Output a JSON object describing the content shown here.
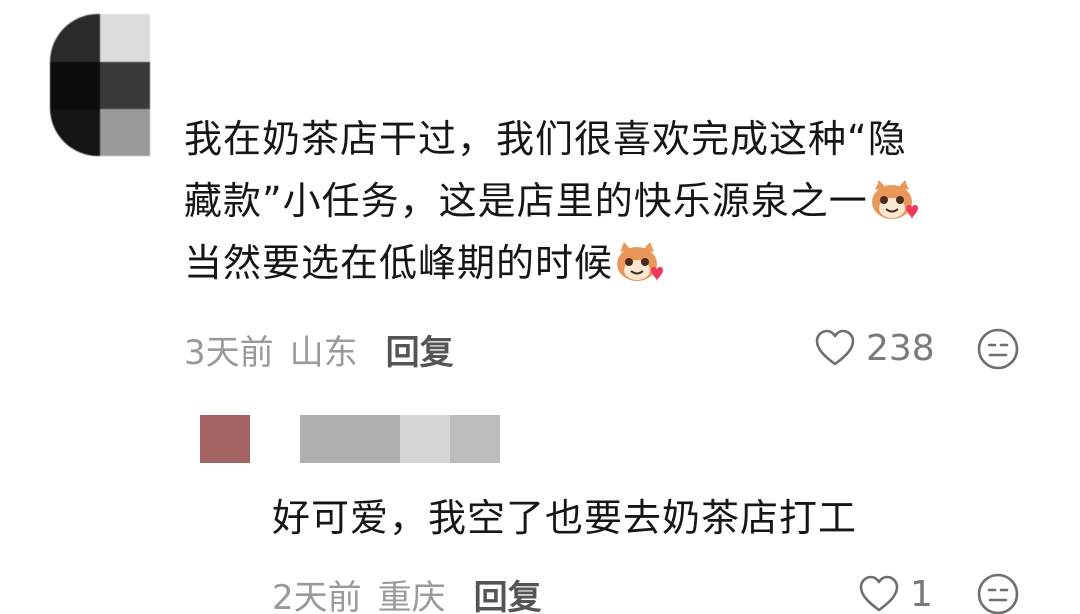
{
  "comments": [
    {
      "text_line1": "我在奶茶店干过，我们很喜欢完成这种“隐",
      "text_line2": "藏款”小任务，这是店里的快乐源泉之一",
      "text_line3": "当然要选在低峰期的时候",
      "time": "3天前",
      "location": "山东",
      "reply_label": "回复",
      "likes": "238"
    },
    {
      "text": "好可爱，我空了也要去奶茶店打工",
      "time": "2天前",
      "location": "重庆",
      "reply_label": "回复",
      "likes": "1"
    }
  ],
  "colors": {
    "text": "#161616",
    "meta": "#9a9a9a",
    "reply": "#555555",
    "reply_avatar": "#a36363"
  },
  "icons": [
    "heart-outline-icon",
    "neutral-face-icon",
    "cat-heart-emoji-icon"
  ]
}
